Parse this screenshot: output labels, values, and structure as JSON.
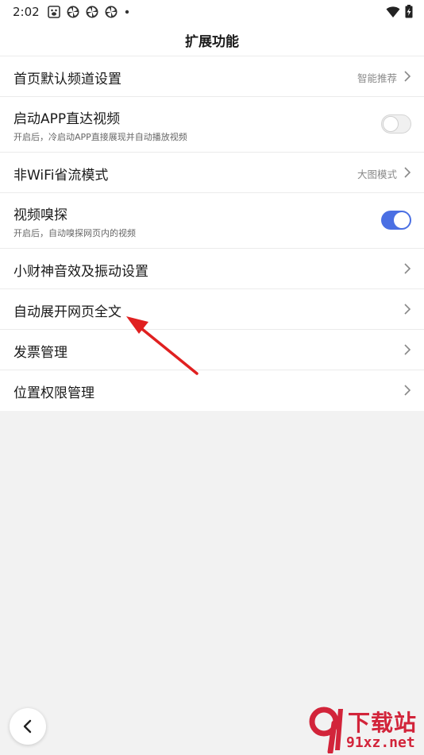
{
  "status_bar": {
    "time": "2:02",
    "icons": [
      "baidu-app-icon",
      "pinwheel-icon",
      "pinwheel-icon",
      "pinwheel-icon",
      "dot-icon"
    ],
    "right_icons": [
      "wifi-icon",
      "battery-charging-icon"
    ]
  },
  "header": {
    "title": "扩展功能"
  },
  "settings": [
    {
      "title": "首页默认频道设置",
      "value": "智能推荐",
      "control": "chevron"
    },
    {
      "title": "启动APP直达视频",
      "subtitle": "开启后，冷启动APP直接展现并自动播放视频",
      "control": "toggle",
      "on": false
    },
    {
      "title": "非WiFi省流模式",
      "value": "大图模式",
      "control": "chevron"
    },
    {
      "title": "视频嗅探",
      "subtitle": "开启后，自动嗅探网页内的视频",
      "control": "toggle",
      "on": true
    },
    {
      "title": "小财神音效及振动设置",
      "control": "chevron"
    },
    {
      "title": "自动展开网页全文",
      "control": "chevron"
    },
    {
      "title": "发票管理",
      "control": "chevron"
    },
    {
      "title": "位置权限管理",
      "control": "chevron"
    }
  ],
  "colors": {
    "toggle_on": "#4a6fe3",
    "annotation_arrow": "#e02020",
    "watermark": "#d2243a"
  },
  "watermark": {
    "line1": "下载站",
    "line2": "91xz.net"
  }
}
